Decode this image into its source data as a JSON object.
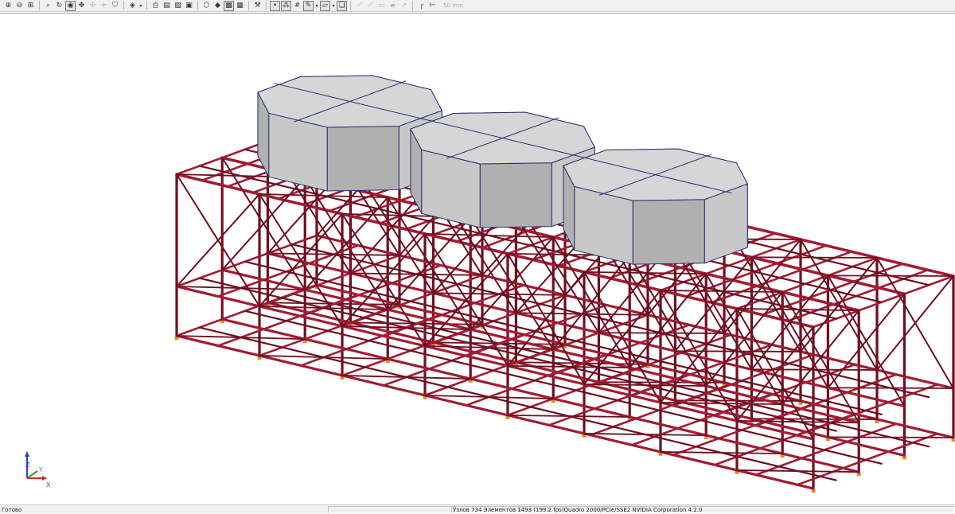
{
  "toolbar": {
    "buttons": [
      {
        "name": "zoom-in-icon",
        "glyph": "⊕"
      },
      {
        "name": "zoom-out-icon",
        "glyph": "⊖"
      },
      {
        "name": "zoom-window-icon",
        "glyph": "⊞"
      },
      {
        "sep": true
      },
      {
        "name": "zoom-all-icon",
        "glyph": "⌕"
      },
      {
        "name": "rotate-icon",
        "glyph": "↻"
      },
      {
        "name": "zoom-dynamic-icon",
        "glyph": "◉",
        "pressed": true
      },
      {
        "name": "pan-icon",
        "glyph": "✥"
      },
      {
        "name": "select-nodes-icon",
        "glyph": "✣",
        "dim": true
      },
      {
        "name": "select-elements-icon",
        "glyph": "✢",
        "dim": true
      },
      {
        "name": "shield-icon",
        "glyph": "⛉"
      },
      {
        "sep": true
      },
      {
        "name": "view-cube-icon",
        "glyph": "◈",
        "arrow": true
      },
      {
        "sep": true
      },
      {
        "name": "print-icon",
        "glyph": "⎙"
      },
      {
        "name": "print-preview-icon",
        "glyph": "▤"
      },
      {
        "name": "document-icon",
        "glyph": "▧"
      },
      {
        "name": "save-icon",
        "glyph": "▣"
      },
      {
        "sep": true
      },
      {
        "name": "model-icon",
        "glyph": "⬡"
      },
      {
        "name": "filled-cube-icon",
        "glyph": "◆"
      },
      {
        "name": "cube-shaded-icon",
        "glyph": "▩",
        "pressed": true
      },
      {
        "name": "cube-icon",
        "glyph": "▦"
      },
      {
        "sep": true
      },
      {
        "name": "magic-wand-icon",
        "glyph": "⚒"
      },
      {
        "sep": true
      },
      {
        "name": "point-icon",
        "glyph": "•",
        "pressed": true
      },
      {
        "name": "nodes-icon",
        "glyph": "⁂",
        "pressed": true
      },
      {
        "name": "grid-icon",
        "glyph": "#"
      },
      {
        "name": "pencil-icon",
        "glyph": "✎",
        "pressed": true,
        "arrow": true
      },
      {
        "name": "eraser-icon",
        "glyph": "▱",
        "pressed": true,
        "arrow": true
      },
      {
        "name": "layers-icon",
        "glyph": "❏",
        "pressed": true
      },
      {
        "sep": true
      },
      {
        "name": "wand-disabled-icon",
        "glyph": "⟋",
        "dim": true
      },
      {
        "name": "line-disabled-icon",
        "glyph": "⟋",
        "dim": true
      },
      {
        "name": "rect-disabled-icon",
        "glyph": "▭",
        "dim": true
      },
      {
        "name": "erase-disabled-icon",
        "glyph": "▰",
        "dim": true
      },
      {
        "name": "arrow-disabled-icon",
        "glyph": "↗",
        "dim": true
      },
      {
        "sep": true
      },
      {
        "name": "corner-icon",
        "glyph": "┌"
      },
      {
        "name": "scale-icon",
        "glyph": "⊢"
      }
    ],
    "scale_text": "50 mm"
  },
  "axes": {
    "z": "Z",
    "y": "Y",
    "x": "X"
  },
  "status": {
    "ready": "Готово",
    "info": "Узлов 734  Элементов 1493  (199.2 fps)Quadro 2000/PCIe/SSE2 NVIDIA Corporation 4.2.0"
  },
  "colors": {
    "beam": "#a31b33",
    "beam_dark": "#6e0f20",
    "tank_face": "#c8c8c8",
    "tank_face_dark": "#b0b0b0",
    "tank_edge": "#2a3070",
    "axis_z": "#2a3fd0",
    "axis_y": "#27a327",
    "axis_x": "#d42a2a"
  }
}
